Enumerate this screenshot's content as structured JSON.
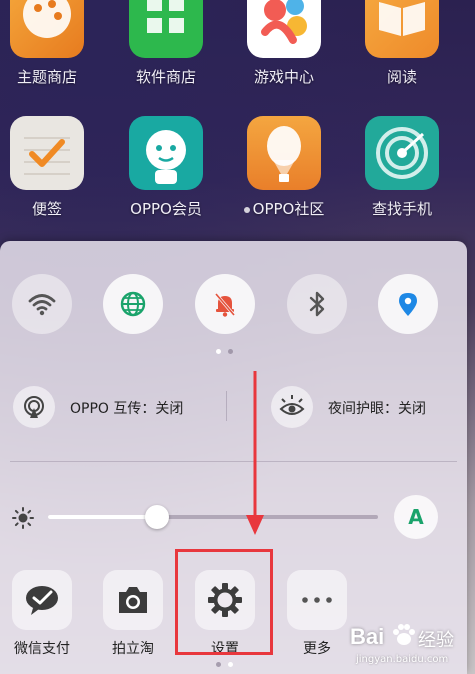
{
  "home_apps": [
    {
      "label": "主题商店"
    },
    {
      "label": "软件商店"
    },
    {
      "label": "游戏中心"
    },
    {
      "label": "阅读"
    },
    {
      "label": "便签"
    },
    {
      "label": "OPPO会员"
    },
    {
      "label": "OPPO社区"
    },
    {
      "label": "查找手机"
    }
  ],
  "quick_toggles": [
    {
      "icon": "wifi-icon",
      "active": false
    },
    {
      "icon": "globe-icon",
      "active": true
    },
    {
      "icon": "bell-muted-icon",
      "active": true
    },
    {
      "icon": "bluetooth-icon",
      "active": false
    },
    {
      "icon": "location-pin-icon",
      "active": true
    }
  ],
  "status_row": {
    "share_label": "OPPO 互传：关闭",
    "eye_care_label": "夜间护眼：关闭"
  },
  "brightness": {
    "level": 0.33,
    "auto_label": "A"
  },
  "shortcuts": [
    {
      "label": "微信支付",
      "icon": "wechat-pay-icon"
    },
    {
      "label": "拍立淘",
      "icon": "camera-icon"
    },
    {
      "label": "设置",
      "icon": "gear-icon"
    },
    {
      "label": "更多",
      "icon": "more-icon"
    }
  ],
  "watermark": {
    "brand": "Bai",
    "brand_suffix": "经验",
    "url": "jingyan.baidu.com"
  },
  "colors": {
    "accent_green": "#1aa36b",
    "alert_orange": "#e5533d",
    "location_blue": "#1e88e5",
    "highlight_red": "#e8373d"
  }
}
